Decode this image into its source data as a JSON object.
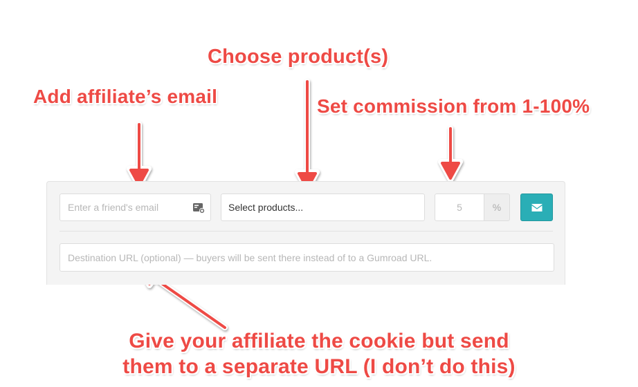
{
  "annotations": {
    "products": "Choose product(s)",
    "email": "Add affiliate’s email",
    "commission": "Set commission from 1-100%",
    "destination_line1": "Give your affiliate the cookie but send",
    "destination_line2": "them to a separate URL (I don’t do this)"
  },
  "form": {
    "email": {
      "placeholder": "Enter a friend's email",
      "icon": "contact-card-icon"
    },
    "products": {
      "placeholder": "Select products..."
    },
    "commission": {
      "placeholder": "5",
      "unit": "%"
    },
    "send_button": {
      "icon": "envelope-icon"
    },
    "destination_url": {
      "placeholder": "Destination URL (optional) — buyers will be sent there instead of to a Gumroad URL."
    }
  },
  "colors": {
    "annotation": "#ee4a45",
    "button": "#2aaeb6",
    "panel": "#f4f4f4"
  }
}
